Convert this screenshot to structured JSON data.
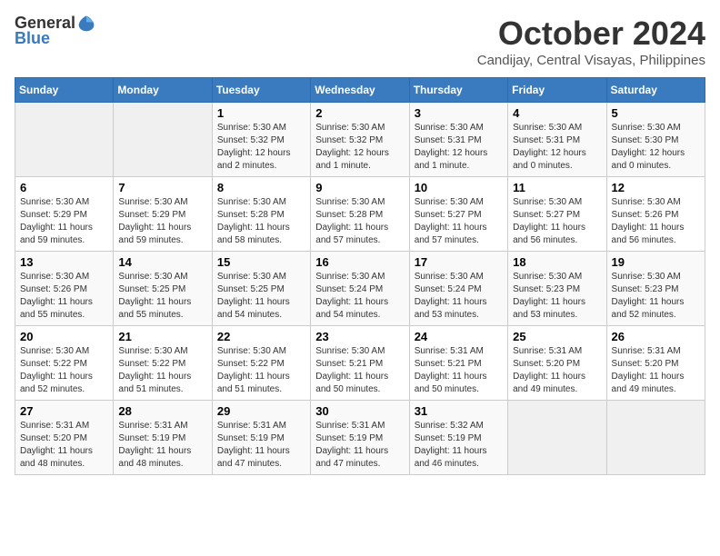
{
  "header": {
    "logo_line1": "General",
    "logo_line2": "Blue",
    "month": "October 2024",
    "location": "Candijay, Central Visayas, Philippines"
  },
  "days_of_week": [
    "Sunday",
    "Monday",
    "Tuesday",
    "Wednesday",
    "Thursday",
    "Friday",
    "Saturday"
  ],
  "weeks": [
    [
      {
        "day": "",
        "info": ""
      },
      {
        "day": "",
        "info": ""
      },
      {
        "day": "1",
        "info": "Sunrise: 5:30 AM\nSunset: 5:32 PM\nDaylight: 12 hours\nand 2 minutes."
      },
      {
        "day": "2",
        "info": "Sunrise: 5:30 AM\nSunset: 5:32 PM\nDaylight: 12 hours\nand 1 minute."
      },
      {
        "day": "3",
        "info": "Sunrise: 5:30 AM\nSunset: 5:31 PM\nDaylight: 12 hours\nand 1 minute."
      },
      {
        "day": "4",
        "info": "Sunrise: 5:30 AM\nSunset: 5:31 PM\nDaylight: 12 hours\nand 0 minutes."
      },
      {
        "day": "5",
        "info": "Sunrise: 5:30 AM\nSunset: 5:30 PM\nDaylight: 12 hours\nand 0 minutes."
      }
    ],
    [
      {
        "day": "6",
        "info": "Sunrise: 5:30 AM\nSunset: 5:29 PM\nDaylight: 11 hours\nand 59 minutes."
      },
      {
        "day": "7",
        "info": "Sunrise: 5:30 AM\nSunset: 5:29 PM\nDaylight: 11 hours\nand 59 minutes."
      },
      {
        "day": "8",
        "info": "Sunrise: 5:30 AM\nSunset: 5:28 PM\nDaylight: 11 hours\nand 58 minutes."
      },
      {
        "day": "9",
        "info": "Sunrise: 5:30 AM\nSunset: 5:28 PM\nDaylight: 11 hours\nand 57 minutes."
      },
      {
        "day": "10",
        "info": "Sunrise: 5:30 AM\nSunset: 5:27 PM\nDaylight: 11 hours\nand 57 minutes."
      },
      {
        "day": "11",
        "info": "Sunrise: 5:30 AM\nSunset: 5:27 PM\nDaylight: 11 hours\nand 56 minutes."
      },
      {
        "day": "12",
        "info": "Sunrise: 5:30 AM\nSunset: 5:26 PM\nDaylight: 11 hours\nand 56 minutes."
      }
    ],
    [
      {
        "day": "13",
        "info": "Sunrise: 5:30 AM\nSunset: 5:26 PM\nDaylight: 11 hours\nand 55 minutes."
      },
      {
        "day": "14",
        "info": "Sunrise: 5:30 AM\nSunset: 5:25 PM\nDaylight: 11 hours\nand 55 minutes."
      },
      {
        "day": "15",
        "info": "Sunrise: 5:30 AM\nSunset: 5:25 PM\nDaylight: 11 hours\nand 54 minutes."
      },
      {
        "day": "16",
        "info": "Sunrise: 5:30 AM\nSunset: 5:24 PM\nDaylight: 11 hours\nand 54 minutes."
      },
      {
        "day": "17",
        "info": "Sunrise: 5:30 AM\nSunset: 5:24 PM\nDaylight: 11 hours\nand 53 minutes."
      },
      {
        "day": "18",
        "info": "Sunrise: 5:30 AM\nSunset: 5:23 PM\nDaylight: 11 hours\nand 53 minutes."
      },
      {
        "day": "19",
        "info": "Sunrise: 5:30 AM\nSunset: 5:23 PM\nDaylight: 11 hours\nand 52 minutes."
      }
    ],
    [
      {
        "day": "20",
        "info": "Sunrise: 5:30 AM\nSunset: 5:22 PM\nDaylight: 11 hours\nand 52 minutes."
      },
      {
        "day": "21",
        "info": "Sunrise: 5:30 AM\nSunset: 5:22 PM\nDaylight: 11 hours\nand 51 minutes."
      },
      {
        "day": "22",
        "info": "Sunrise: 5:30 AM\nSunset: 5:22 PM\nDaylight: 11 hours\nand 51 minutes."
      },
      {
        "day": "23",
        "info": "Sunrise: 5:30 AM\nSunset: 5:21 PM\nDaylight: 11 hours\nand 50 minutes."
      },
      {
        "day": "24",
        "info": "Sunrise: 5:31 AM\nSunset: 5:21 PM\nDaylight: 11 hours\nand 50 minutes."
      },
      {
        "day": "25",
        "info": "Sunrise: 5:31 AM\nSunset: 5:20 PM\nDaylight: 11 hours\nand 49 minutes."
      },
      {
        "day": "26",
        "info": "Sunrise: 5:31 AM\nSunset: 5:20 PM\nDaylight: 11 hours\nand 49 minutes."
      }
    ],
    [
      {
        "day": "27",
        "info": "Sunrise: 5:31 AM\nSunset: 5:20 PM\nDaylight: 11 hours\nand 48 minutes."
      },
      {
        "day": "28",
        "info": "Sunrise: 5:31 AM\nSunset: 5:19 PM\nDaylight: 11 hours\nand 48 minutes."
      },
      {
        "day": "29",
        "info": "Sunrise: 5:31 AM\nSunset: 5:19 PM\nDaylight: 11 hours\nand 47 minutes."
      },
      {
        "day": "30",
        "info": "Sunrise: 5:31 AM\nSunset: 5:19 PM\nDaylight: 11 hours\nand 47 minutes."
      },
      {
        "day": "31",
        "info": "Sunrise: 5:32 AM\nSunset: 5:19 PM\nDaylight: 11 hours\nand 46 minutes."
      },
      {
        "day": "",
        "info": ""
      },
      {
        "day": "",
        "info": ""
      }
    ]
  ]
}
